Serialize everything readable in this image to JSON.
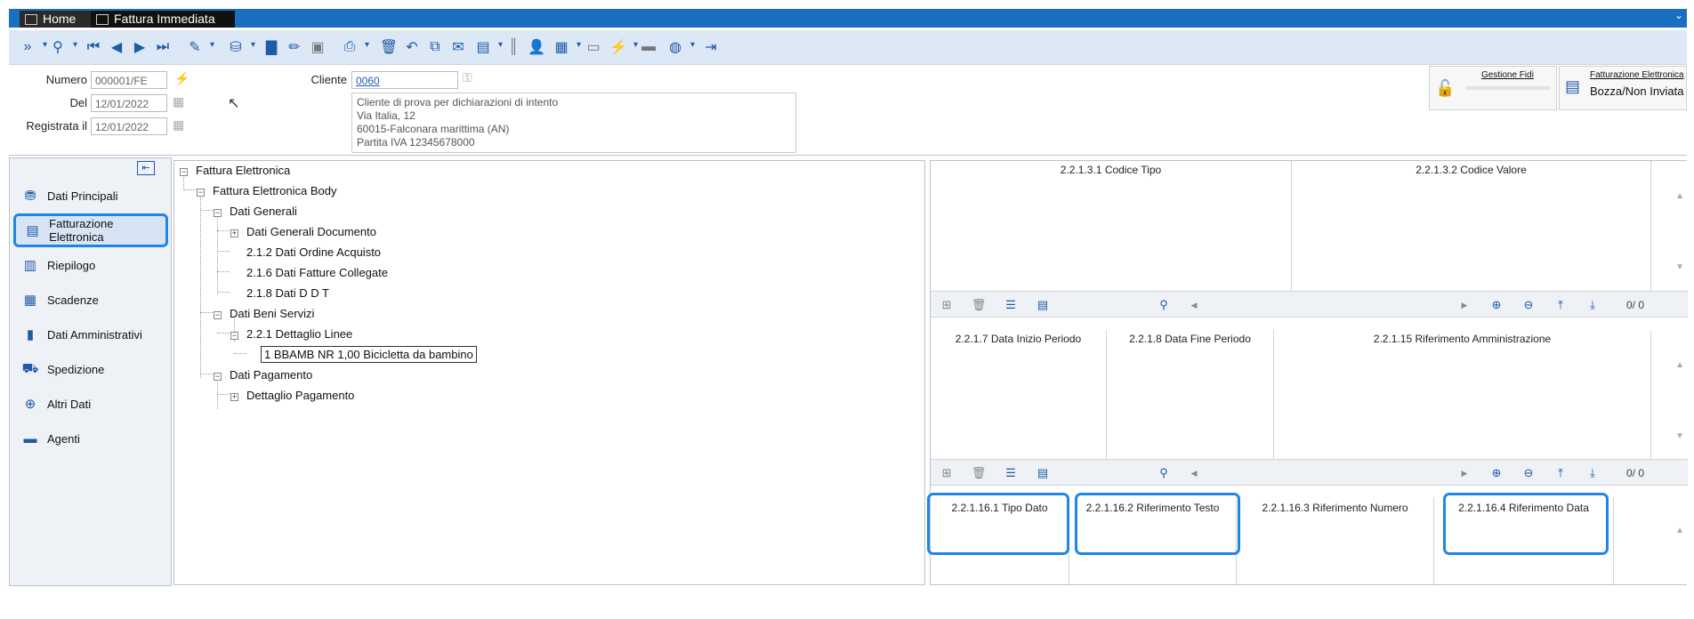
{
  "window": {
    "tabs": [
      {
        "label": "Home"
      },
      {
        "label": "Fattura Immediata"
      }
    ]
  },
  "header": {
    "numero_label": "Numero",
    "numero_value": "000001/FE",
    "del_label": "Del",
    "del_value": "12/01/2022",
    "registrata_label": "Registrata il",
    "registrata_value": "12/01/2022",
    "cliente_label": "Cliente",
    "cliente_code": "0060",
    "cliente_address": [
      "Cliente di prova per dichiarazioni di intento",
      "Via Italia, 12",
      "60015-Falconara marittima (AN)",
      "Partita IVA 12345678000"
    ],
    "gestione_fidi_label": "Gestione Fidi",
    "fe_title": "Fatturazione Elettronica",
    "fe_status": "Bozza/Non Inviata"
  },
  "sidebar": {
    "items": [
      {
        "label": "Dati Principali",
        "icon": "person-stack-icon"
      },
      {
        "label": "Fatturazione Elettronica",
        "icon": "globe-doc-icon"
      },
      {
        "label": "Riepilogo",
        "icon": "summary-icon"
      },
      {
        "label": "Scadenze",
        "icon": "calendar-icon"
      },
      {
        "label": "Dati Amministrativi",
        "icon": "ledger-icon"
      },
      {
        "label": "Spedizione",
        "icon": "truck-icon"
      },
      {
        "label": "Altri Dati",
        "icon": "plus-person-icon"
      },
      {
        "label": "Agenti",
        "icon": "briefcase-icon"
      }
    ]
  },
  "tree": {
    "root": "Fattura Elettronica",
    "body": "Fattura Elettronica Body",
    "dati_generali": "Dati Generali",
    "dati_generali_documento": "Dati Generali Documento",
    "ordine_acquisto": "2.1.2 Dati Ordine Acquisto",
    "fatture_collegate": "2.1.6 Dati Fatture Collegate",
    "ddt": "2.1.8 Dati D D T",
    "beni_servizi": "Dati Beni Servizi",
    "dettaglio_linee": "2.2.1 Dettaglio Linee",
    "linea": "1 BBAMB NR 1,00 Bicicletta da bambino",
    "dati_pagamento": "Dati Pagamento",
    "dettaglio_pagamento": "Dettaglio Pagamento"
  },
  "grid1": {
    "headers": [
      "2.2.1.3.1 Codice Tipo",
      "2.2.1.3.2 Codice Valore"
    ],
    "pager": "0/   0"
  },
  "grid2": {
    "headers": [
      "2.2.1.7 Data Inizio Periodo",
      "2.2.1.8 Data Fine Periodo",
      "2.2.1.15 Riferimento Amministrazione"
    ],
    "pager": "0/   0"
  },
  "grid3": {
    "headers": [
      "2.2.1.16.1 Tipo Dato",
      "2.2.1.16.2 Riferimento Testo",
      "2.2.1.16.3 Riferimento Numero",
      "2.2.1.16.4 Riferimento Data"
    ]
  },
  "colors": {
    "accent": "#1b6fc0",
    "highlight": "#1f86e3",
    "toolbar_bg": "#dce8f6"
  }
}
